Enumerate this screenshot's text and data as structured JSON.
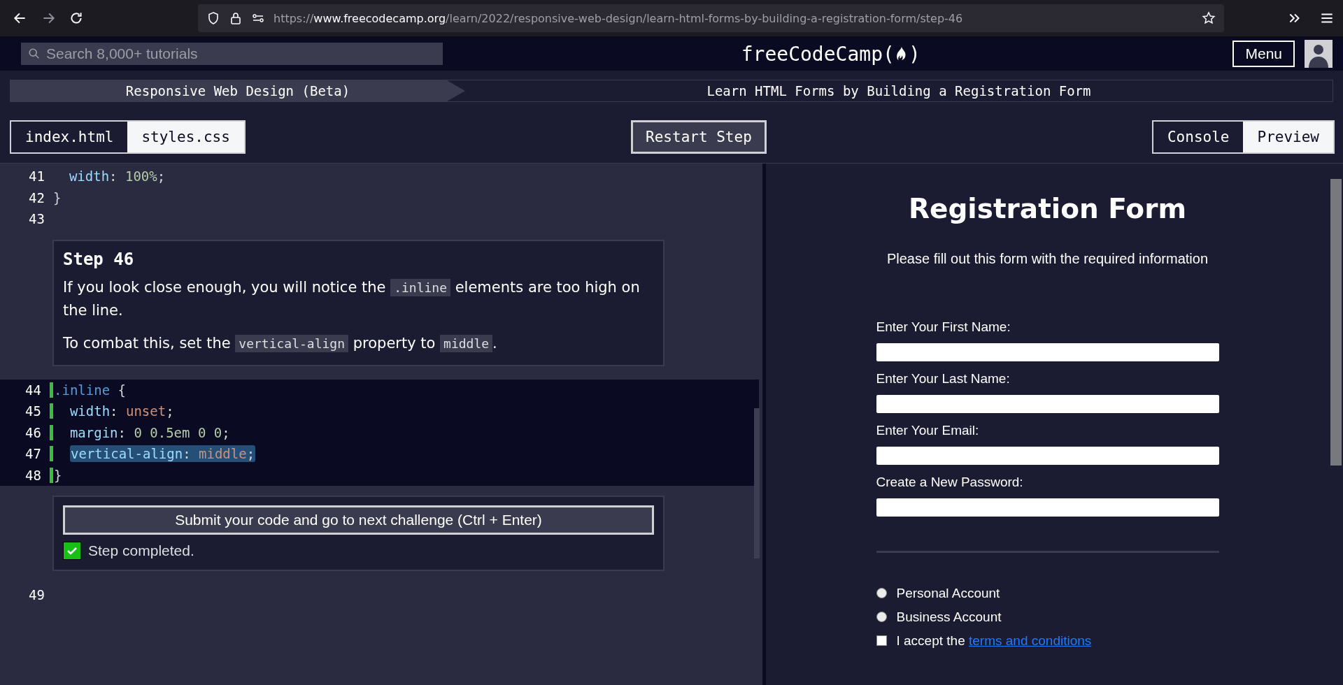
{
  "browser": {
    "url": {
      "scheme": "https://",
      "host": "www.freecodecamp.org",
      "path": "/learn/2022/responsive-web-design/learn-html-forms-by-building-a-registration-form/step-46"
    }
  },
  "nav": {
    "search": {
      "placeholder": "Search 8,000+ tutorials"
    },
    "logo": {
      "before": "freeCodeCamp(",
      "after": ")"
    },
    "menu_button": "Menu"
  },
  "breadcrumb": [
    "Responsive Web Design (Beta)",
    "Learn HTML Forms by Building a Registration Form"
  ],
  "file_tabs": [
    {
      "label": "index.html",
      "selected": false
    },
    {
      "label": "styles.css",
      "selected": true
    }
  ],
  "restart_button": "Restart Step",
  "view_tabs": [
    {
      "label": "Console",
      "selected": false
    },
    {
      "label": "Preview",
      "selected": true
    }
  ],
  "code_before": [
    {
      "number": "41",
      "tokens": [
        {
          "kind": "prop",
          "text": "  width"
        },
        {
          "kind": "punct",
          "text": ": "
        },
        {
          "kind": "num",
          "text": "100%"
        },
        {
          "kind": "punct",
          "text": ";"
        }
      ]
    },
    {
      "number": "42",
      "tokens": [
        {
          "kind": "punct",
          "text": "}"
        }
      ]
    },
    {
      "number": "43"
    }
  ],
  "instructions": {
    "title": "Step 46",
    "paragraphs": [
      [
        {
          "kind": "text",
          "text": "If you look close enough, you will notice the "
        },
        {
          "kind": "code",
          "text": ".inline"
        },
        {
          "kind": "text",
          "text": " elements are too high on the line."
        }
      ],
      [
        {
          "kind": "text",
          "text": "To combat this, set the "
        },
        {
          "kind": "code",
          "text": "vertical-align"
        },
        {
          "kind": "text",
          "text": " property to "
        },
        {
          "kind": "code",
          "text": "middle"
        },
        {
          "kind": "text",
          "text": "."
        }
      ]
    ]
  },
  "editable_lines": [
    {
      "number": "44",
      "highlighted": false,
      "tokens": [
        {
          "kind": "selector",
          "text": ".inline"
        },
        {
          "kind": "punct",
          "text": " {"
        }
      ]
    },
    {
      "number": "45",
      "highlighted": false,
      "tokens": [
        {
          "kind": "prop",
          "text": "  width"
        },
        {
          "kind": "punct",
          "text": ": "
        },
        {
          "kind": "keyword",
          "text": "unset"
        },
        {
          "kind": "punct",
          "text": ";"
        }
      ]
    },
    {
      "number": "46",
      "highlighted": false,
      "tokens": [
        {
          "kind": "prop",
          "text": "  margin"
        },
        {
          "kind": "punct",
          "text": ": "
        },
        {
          "kind": "num",
          "text": "0 0.5em 0 0"
        },
        {
          "kind": "punct",
          "text": ";"
        }
      ]
    },
    {
      "number": "47",
      "highlighted": true,
      "tokens": [
        {
          "kind": "prop",
          "text": "vertical-align"
        },
        {
          "kind": "punct",
          "text": ": "
        },
        {
          "kind": "keyword",
          "text": "middle"
        },
        {
          "kind": "punct",
          "text": ";"
        }
      ]
    },
    {
      "number": "48",
      "highlighted": false,
      "tokens": [
        {
          "kind": "punct",
          "text": "}"
        }
      ]
    }
  ],
  "submit": {
    "button": "Submit your code and go to next challenge (Ctrl + Enter)",
    "status": {
      "text": "Step completed.",
      "checked": true
    }
  },
  "code_after": [
    {
      "number": "49"
    }
  ],
  "preview": {
    "title": "Registration Form",
    "subtitle": "Please fill out this form with the required information",
    "fields": [
      {
        "label": "Enter Your First Name:"
      },
      {
        "label": "Enter Your Last Name:"
      },
      {
        "label": "Enter Your Email:"
      },
      {
        "label": "Create a New Password:"
      }
    ],
    "radios": [
      {
        "label": "Personal Account",
        "selected": false
      },
      {
        "label": "Business Account",
        "selected": false
      }
    ],
    "terms": {
      "before": "I accept the ",
      "link": "terms and conditions",
      "checked": false
    }
  }
}
